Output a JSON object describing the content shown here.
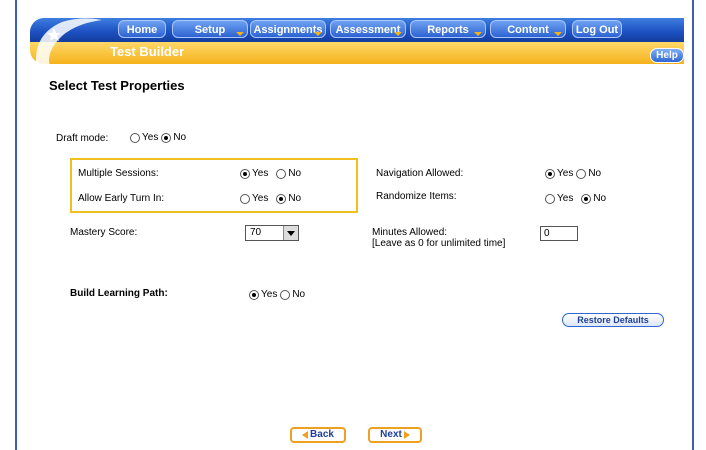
{
  "nav": {
    "items": [
      {
        "label": "Home"
      },
      {
        "label": "Setup"
      },
      {
        "label": "Assignments"
      },
      {
        "label": "Assessment"
      },
      {
        "label": "Reports"
      },
      {
        "label": "Content"
      },
      {
        "label": "Log Out"
      }
    ]
  },
  "header": {
    "page_title": "Test Builder",
    "help_label": "Help"
  },
  "main": {
    "title": "Select Test Properties",
    "draft_mode": {
      "label": "Draft mode:",
      "yes": "Yes",
      "no": "No",
      "selected": "No"
    },
    "multiple_sessions": {
      "label": "Multiple Sessions:",
      "yes": "Yes",
      "no": "No",
      "selected": "Yes"
    },
    "allow_early_turn_in": {
      "label": "Allow Early Turn In:",
      "yes": "Yes",
      "no": "No",
      "selected": "No"
    },
    "navigation_allowed": {
      "label": "Navigation Allowed:",
      "yes": "Yes",
      "no": "No",
      "selected": "Yes"
    },
    "randomize_items": {
      "label": "Randomize Items:",
      "yes": "Yes",
      "no": "No",
      "selected": "No"
    },
    "mastery_score": {
      "label": "Mastery Score:",
      "value": "70"
    },
    "minutes_allowed": {
      "label": "Minutes Allowed:",
      "hint": "[Leave as 0 for unlimited time]",
      "value": "0"
    },
    "build_learning_path": {
      "label": "Build Learning Path:",
      "yes": "Yes",
      "no": "No",
      "selected": "Yes"
    },
    "restore_defaults_label": "Restore Defaults",
    "back_label": "Back",
    "next_label": "Next"
  },
  "colors": {
    "nav_blue": "#1c4fc0",
    "header_gold": "#f5b21a",
    "highlight_border": "#f0c020"
  }
}
